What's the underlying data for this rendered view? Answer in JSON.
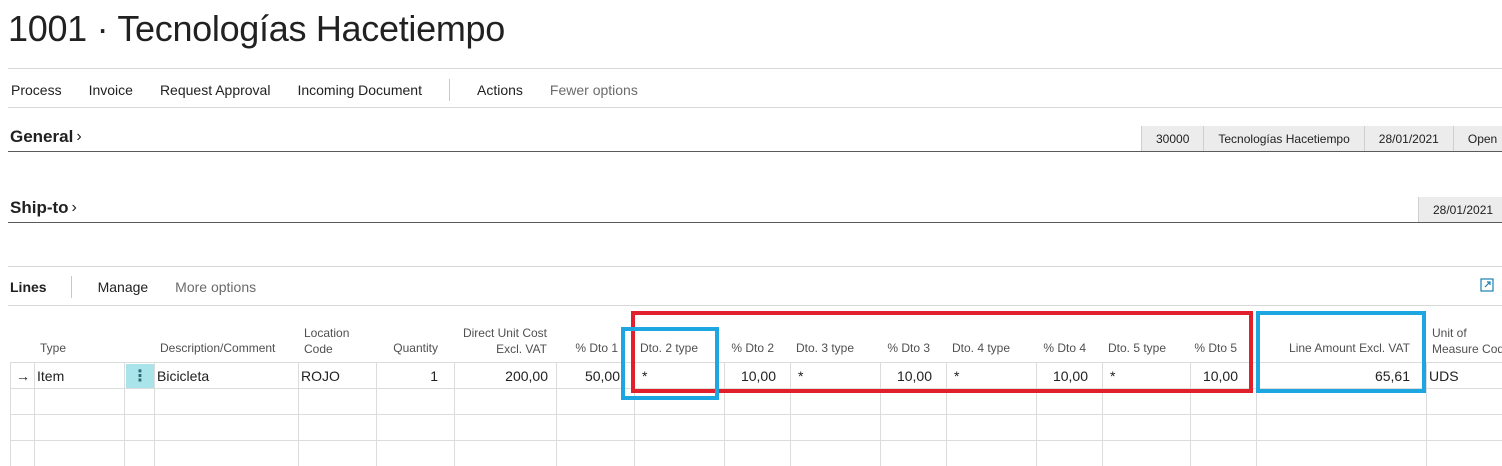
{
  "page": {
    "title": "1001 · Tecnologías Hacetiempo"
  },
  "actions": [
    "Process",
    "Invoice",
    "Request Approval",
    "Incoming Document"
  ],
  "actions_more": "Actions",
  "actions_fewer": "Fewer options",
  "general": {
    "title": "General",
    "chevron": "›",
    "summary": [
      "30000",
      "Tecnologías Hacetiempo",
      "28/01/2021",
      "Open"
    ]
  },
  "shipto": {
    "title": "Ship-to",
    "chevron": "›",
    "summary": [
      "28/01/2021"
    ]
  },
  "lines": {
    "title": "Lines",
    "manage": "Manage",
    "more": "More options",
    "columns": {
      "type": "Type",
      "description": "Description/Comment",
      "location_1": "Location",
      "location_2": "Code",
      "quantity": "Quantity",
      "cost_1": "Direct Unit Cost",
      "cost_2": "Excl. VAT",
      "dto1": "% Dto 1",
      "dto2type": "Dto. 2 type",
      "dto2": "% Dto 2",
      "dto3type": "Dto. 3 type",
      "dto3": "% Dto 3",
      "dto4type": "Dto. 4 type",
      "dto4": "% Dto 4",
      "dto5type": "Dto. 5 type",
      "dto5": "% Dto 5",
      "amount": "Line Amount Excl. VAT",
      "uom_1": "Unit of",
      "uom_2": "Measure Cod"
    },
    "row": {
      "arrow": "→",
      "type": "Item",
      "menu": "⋮",
      "description": "Bicicleta",
      "location": "ROJO",
      "quantity": "1",
      "cost": "200,00",
      "dto1": "50,00",
      "dto2type": "*",
      "dto2": "10,00",
      "dto3type": "*",
      "dto3": "10,00",
      "dto4type": "*",
      "dto4": "10,00",
      "dto5type": "*",
      "dto5": "10,00",
      "amount": "65,61",
      "uom": "UDS"
    }
  },
  "colors": {
    "highlight_red": "#e0202a",
    "highlight_blue": "#1ea6e0",
    "menu_cell_bg": "#a9e4ea"
  }
}
